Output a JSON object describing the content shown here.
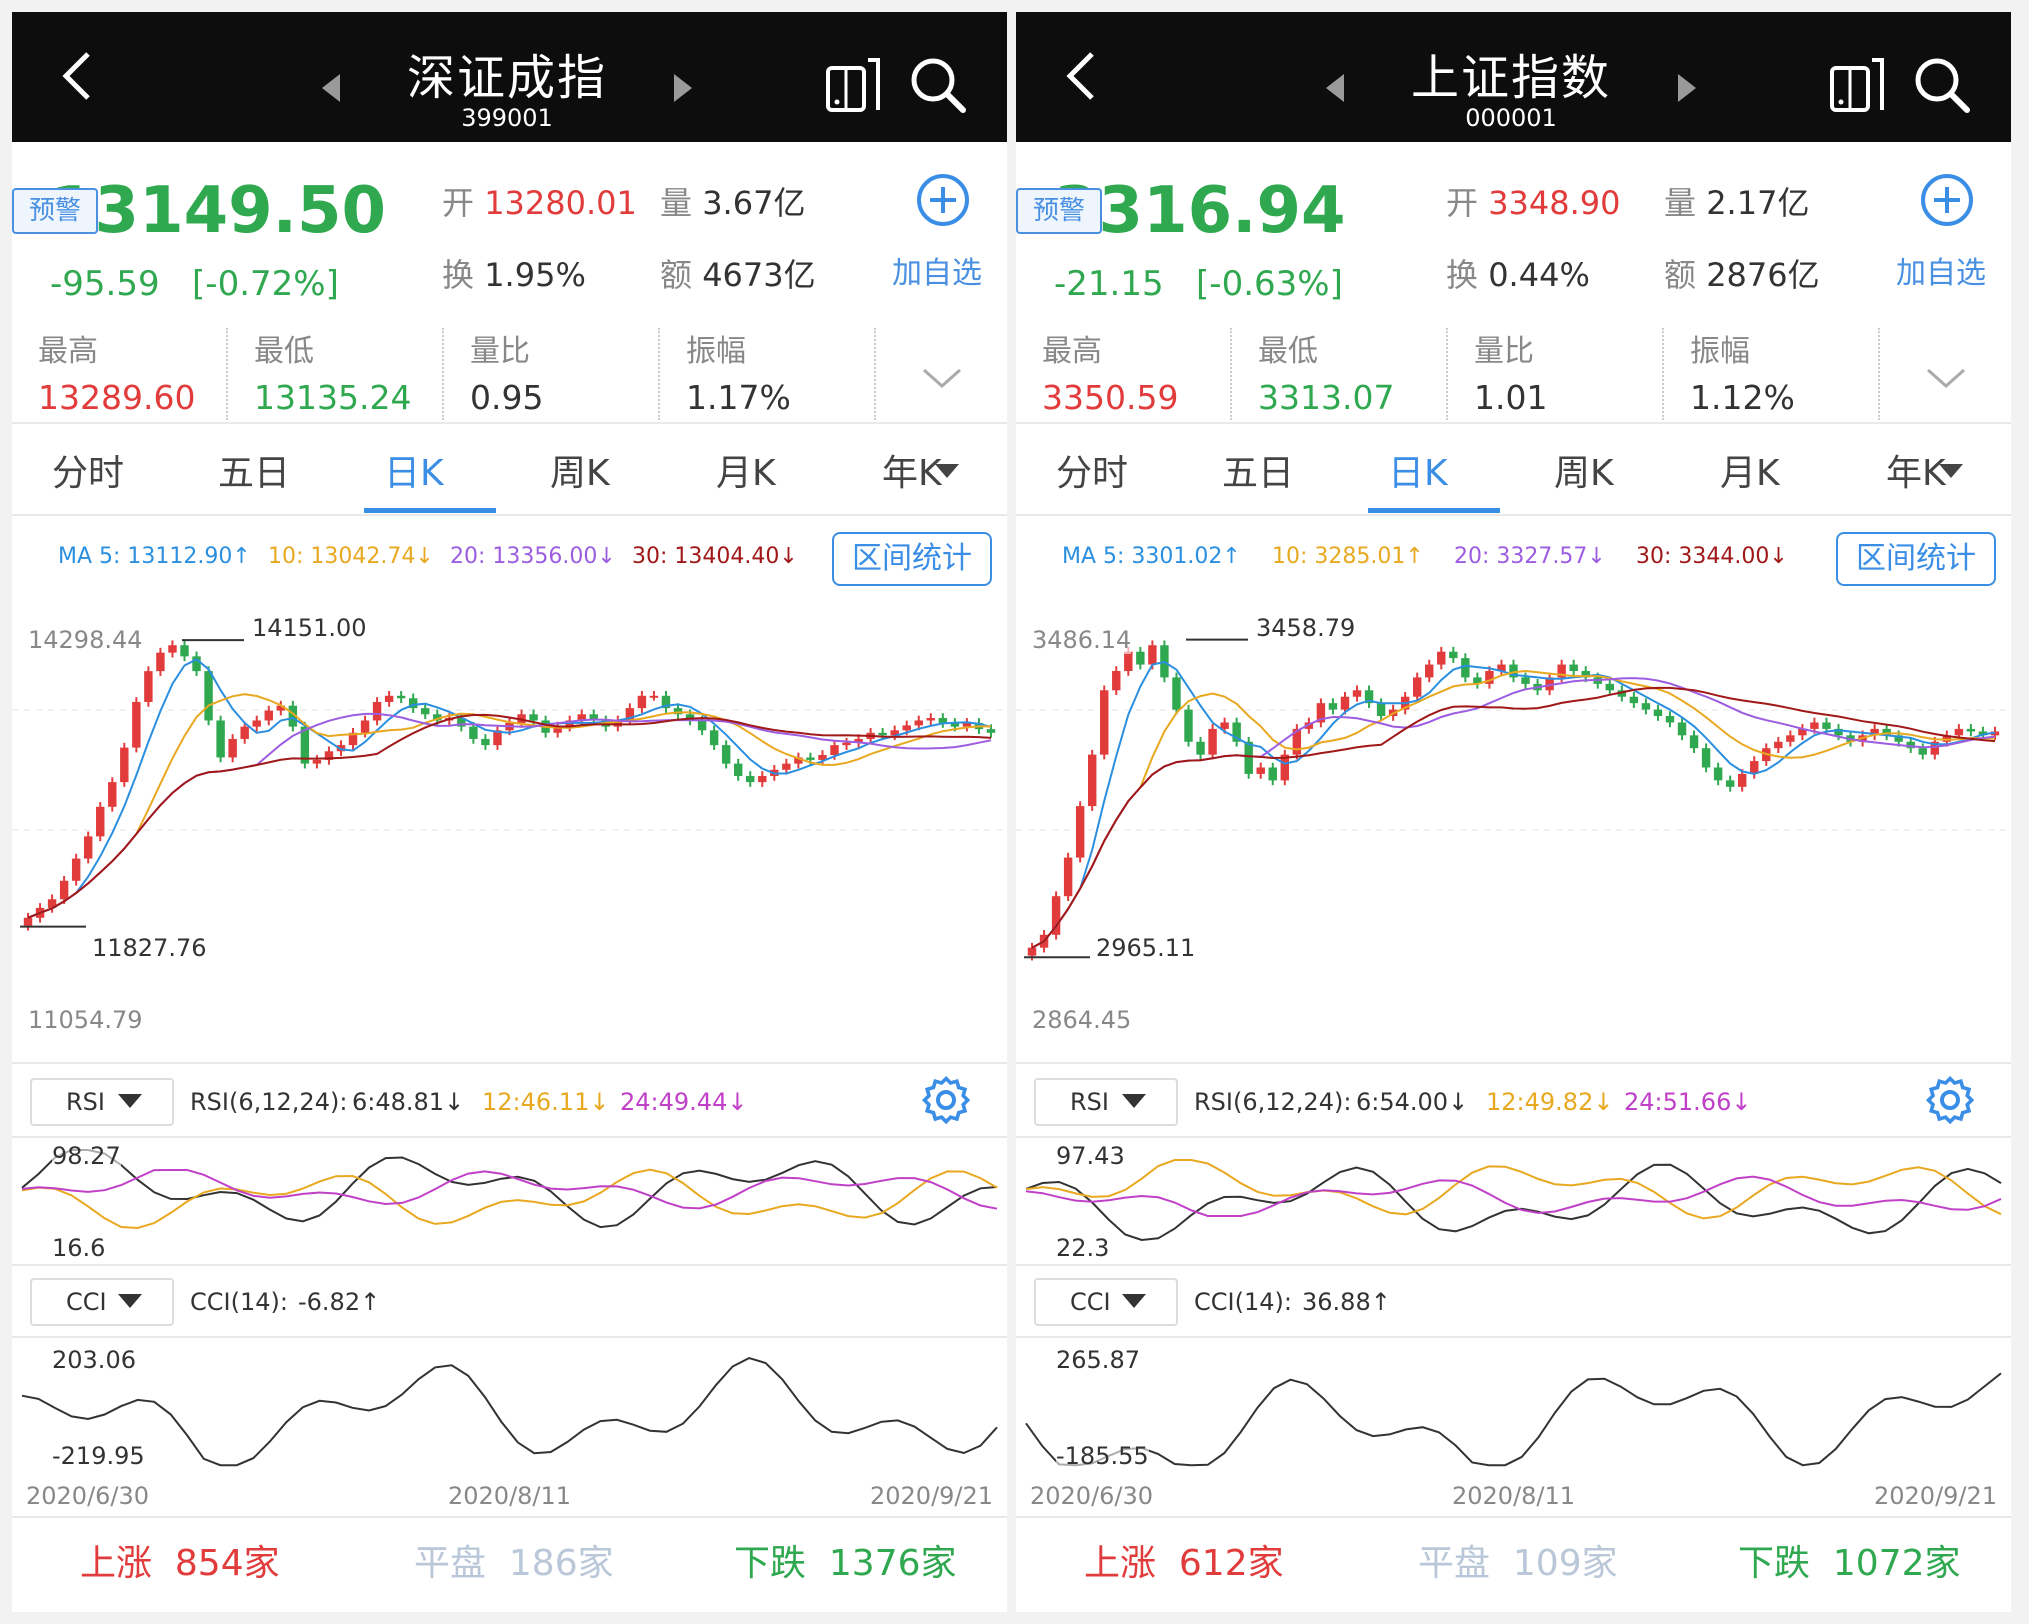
{
  "panels": [
    {
      "title": "深证成指",
      "code": "399001",
      "price": "13149.50",
      "alert_label": "预警",
      "change": "-95.59",
      "change_pct": "[-0.72%]",
      "open_label": "开",
      "open": "13280.01",
      "vol_label": "量",
      "vol": "3.67亿",
      "turnover_label": "换",
      "turnover": "1.95%",
      "amount_label": "额",
      "amount": "4673亿",
      "add_label": "加自选",
      "stats": [
        {
          "label": "最高",
          "value": "13289.60",
          "color": "#e13b3b"
        },
        {
          "label": "最低",
          "value": "13135.24",
          "color": "#2fa84f"
        },
        {
          "label": "量比",
          "value": "0.95",
          "color": "#333333"
        },
        {
          "label": "振幅",
          "value": "1.17%",
          "color": "#333333"
        }
      ],
      "tabs": [
        "分时",
        "五日",
        "日K",
        "周K",
        "月K",
        "年K"
      ],
      "active_tab": 2,
      "ma": [
        {
          "text": "MA 5: 13112.90↑",
          "color": "#2b8fe0"
        },
        {
          "text": "10: 13042.74↓",
          "color": "#e8a820"
        },
        {
          "text": "20: 13356.00↓",
          "color": "#9c5de0"
        },
        {
          "text": "30: 13404.40↓",
          "color": "#a01818"
        }
      ],
      "range_btn": "区间统计",
      "top_price": "14298.44",
      "bottom_price": "11054.79",
      "max_mark": "14151.00",
      "min_mark": "11827.76",
      "rsi_btn": "RSI",
      "rsi_params": "RSI(6,12,24):",
      "rsi_vals": [
        {
          "text": "6:48.81↓",
          "color": "#333333"
        },
        {
          "text": "12:46.11↓",
          "color": "#e8a820"
        },
        {
          "text": "24:49.44↓",
          "color": "#c040c8"
        }
      ],
      "rsi_top": "98.27",
      "rsi_bottom": "16.6",
      "cci_btn": "CCI",
      "cci_params": "CCI(14):",
      "cci_val": "-6.82↑",
      "cci_top": "203.06",
      "cci_bottom": "-219.95",
      "dates": [
        "2020/6/30",
        "2020/8/11",
        "2020/9/21"
      ],
      "up_label": "上涨",
      "up": "854家",
      "flat_label": "平盘",
      "flat": "186家",
      "down_label": "下跌",
      "down": "1376家",
      "chart_data": {
        "type": "candlestick",
        "price_range": [
          11054.79,
          14298.44
        ],
        "max": 14151.0,
        "min": 11827.76,
        "closes": [
          11900,
          11980,
          12050,
          12200,
          12380,
          12560,
          12800,
          13000,
          13280,
          13650,
          13900,
          14050,
          14110,
          14020,
          13900,
          13500,
          13200,
          13350,
          13450,
          13500,
          13580,
          13620,
          13450,
          13150,
          13180,
          13250,
          13300,
          13400,
          13500,
          13650,
          13700,
          13680,
          13600,
          13550,
          13500,
          13520,
          13450,
          13350,
          13300,
          13420,
          13480,
          13550,
          13500,
          13400,
          13450,
          13500,
          13550,
          13500,
          13450,
          13500,
          13600,
          13700,
          13700,
          13600,
          13550,
          13500,
          13420,
          13300,
          13150,
          13050,
          13000,
          13050,
          13100,
          13150,
          13200,
          13180,
          13220,
          13300,
          13320,
          13350,
          13400,
          13380,
          13420,
          13460,
          13500,
          13520,
          13480,
          13450,
          13480,
          13430,
          13400
        ]
      }
    },
    {
      "title": "上证指数",
      "code": "000001",
      "price": "3316.94",
      "alert_label": "预警",
      "change": "-21.15",
      "change_pct": "[-0.63%]",
      "open_label": "开",
      "open": "3348.90",
      "vol_label": "量",
      "vol": "2.17亿",
      "turnover_label": "换",
      "turnover": "0.44%",
      "amount_label": "额",
      "amount": "2876亿",
      "add_label": "加自选",
      "stats": [
        {
          "label": "最高",
          "value": "3350.59",
          "color": "#e13b3b"
        },
        {
          "label": "最低",
          "value": "3313.07",
          "color": "#2fa84f"
        },
        {
          "label": "量比",
          "value": "1.01",
          "color": "#333333"
        },
        {
          "label": "振幅",
          "value": "1.12%",
          "color": "#333333"
        }
      ],
      "tabs": [
        "分时",
        "五日",
        "日K",
        "周K",
        "月K",
        "年K"
      ],
      "active_tab": 2,
      "ma": [
        {
          "text": "MA 5: 3301.02↑",
          "color": "#2b8fe0"
        },
        {
          "text": "10: 3285.01↑",
          "color": "#e8a820"
        },
        {
          "text": "20: 3327.57↓",
          "color": "#9c5de0"
        },
        {
          "text": "30: 3344.00↓",
          "color": "#a01818"
        }
      ],
      "range_btn": "区间统计",
      "top_price": "3486.14",
      "bottom_price": "2864.45",
      "max_mark": "3458.79",
      "min_mark": "2965.11",
      "rsi_btn": "RSI",
      "rsi_params": "RSI(6,12,24):",
      "rsi_vals": [
        {
          "text": "6:54.00↓",
          "color": "#333333"
        },
        {
          "text": "12:49.82↓",
          "color": "#e8a820"
        },
        {
          "text": "24:51.66↓",
          "color": "#c040c8"
        }
      ],
      "rsi_top": "97.43",
      "rsi_bottom": "22.3",
      "cci_btn": "CCI",
      "cci_params": "CCI(14):",
      "cci_val": "36.88↑",
      "cci_top": "265.87",
      "cci_bottom": "-185.55",
      "dates": [
        "2020/6/30",
        "2020/8/11",
        "2020/9/21"
      ],
      "up_label": "上涨",
      "up": "612家",
      "flat_label": "平盘",
      "flat": "109家",
      "down_label": "下跌",
      "down": "1072家",
      "chart_data": {
        "type": "candlestick",
        "price_range": [
          2864.45,
          3486.14
        ],
        "max": 3458.79,
        "min": 2965.11,
        "closes": [
          2980,
          3000,
          3060,
          3120,
          3200,
          3280,
          3380,
          3410,
          3440,
          3420,
          3450,
          3400,
          3350,
          3300,
          3280,
          3320,
          3330,
          3300,
          3250,
          3260,
          3240,
          3280,
          3320,
          3330,
          3360,
          3350,
          3370,
          3380,
          3360,
          3340,
          3350,
          3370,
          3400,
          3420,
          3440,
          3430,
          3400,
          3390,
          3410,
          3420,
          3400,
          3390,
          3380,
          3400,
          3420,
          3410,
          3400,
          3390,
          3380,
          3370,
          3360,
          3350,
          3340,
          3330,
          3310,
          3290,
          3260,
          3240,
          3230,
          3250,
          3270,
          3290,
          3300,
          3310,
          3320,
          3330,
          3320,
          3310,
          3300,
          3310,
          3320,
          3310,
          3300,
          3290,
          3280,
          3300,
          3310,
          3320,
          3316,
          3310,
          3316
        ]
      }
    }
  ]
}
